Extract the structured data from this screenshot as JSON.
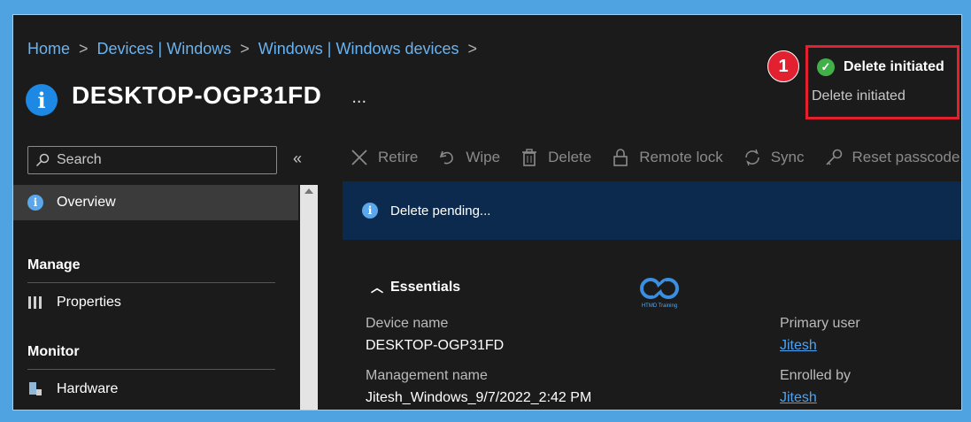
{
  "breadcrumb": {
    "items": [
      "Home",
      "Devices | Windows",
      "Windows | Windows devices"
    ],
    "separator": ">"
  },
  "page": {
    "title": "DESKTOP-OGP31FD",
    "more": "..."
  },
  "notification": {
    "step": "1",
    "title": "Delete initiated",
    "message": "Delete initiated"
  },
  "sidebar": {
    "search_placeholder": "Search",
    "collapse": "«",
    "overview": "Overview",
    "manage_heading": "Manage",
    "properties": "Properties",
    "monitor_heading": "Monitor",
    "hardware": "Hardware"
  },
  "toolbar": {
    "retire": "Retire",
    "wipe": "Wipe",
    "delete": "Delete",
    "remote_lock": "Remote lock",
    "sync": "Sync",
    "reset_passcode": "Reset passcode"
  },
  "banner": {
    "message": "Delete pending..."
  },
  "essentials": {
    "heading": "Essentials",
    "device_name_label": "Device name",
    "device_name": "DESKTOP-OGP31FD",
    "management_name_label": "Management name",
    "management_name": "Jitesh_Windows_9/7/2022_2:42 PM",
    "primary_user_label": "Primary user",
    "primary_user": "Jitesh",
    "enrolled_by_label": "Enrolled by",
    "enrolled_by": "Jitesh"
  },
  "watermark": {
    "text": "HTMD Training"
  },
  "colors": {
    "accent": "#4ea3f0",
    "highlight": "#e22030",
    "success": "#42b049",
    "banner": "#0b2a4e"
  }
}
